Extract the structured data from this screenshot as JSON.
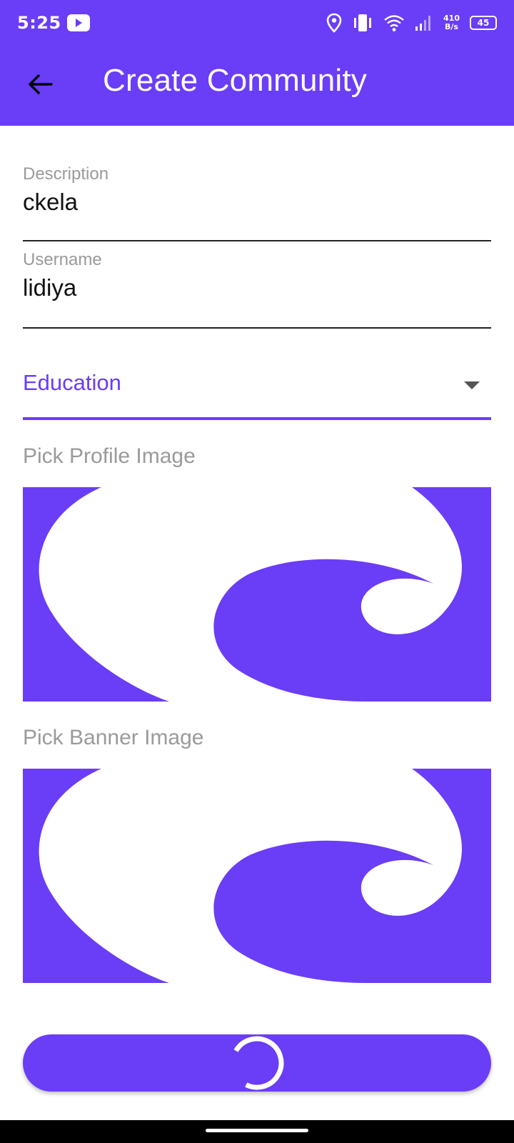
{
  "status_bar": {
    "time": "5:25",
    "net_speed_top": "410",
    "net_speed_bottom": "B/s",
    "battery": "45",
    "icons": [
      "youtube-icon",
      "location-icon",
      "vibrate-icon",
      "wifi-icon",
      "signal-icon",
      "battery-icon"
    ]
  },
  "app_bar": {
    "title": "Create Community",
    "back_icon": "arrow-left-icon"
  },
  "form": {
    "description": {
      "label": "Description",
      "value": "ckela"
    },
    "username": {
      "label": "Username",
      "value": "lidiya"
    },
    "category": {
      "selected": "Education",
      "icon": "dropdown-caret-icon"
    },
    "profile_image": {
      "label": "Pick Profile Image"
    },
    "banner_image": {
      "label": "Pick Banner Image"
    }
  },
  "submit": {
    "state": "loading",
    "icon": "spinner-icon"
  },
  "colors": {
    "primary": "#6a3df7",
    "label_gray": "#9a9a9a",
    "text": "#111111"
  }
}
